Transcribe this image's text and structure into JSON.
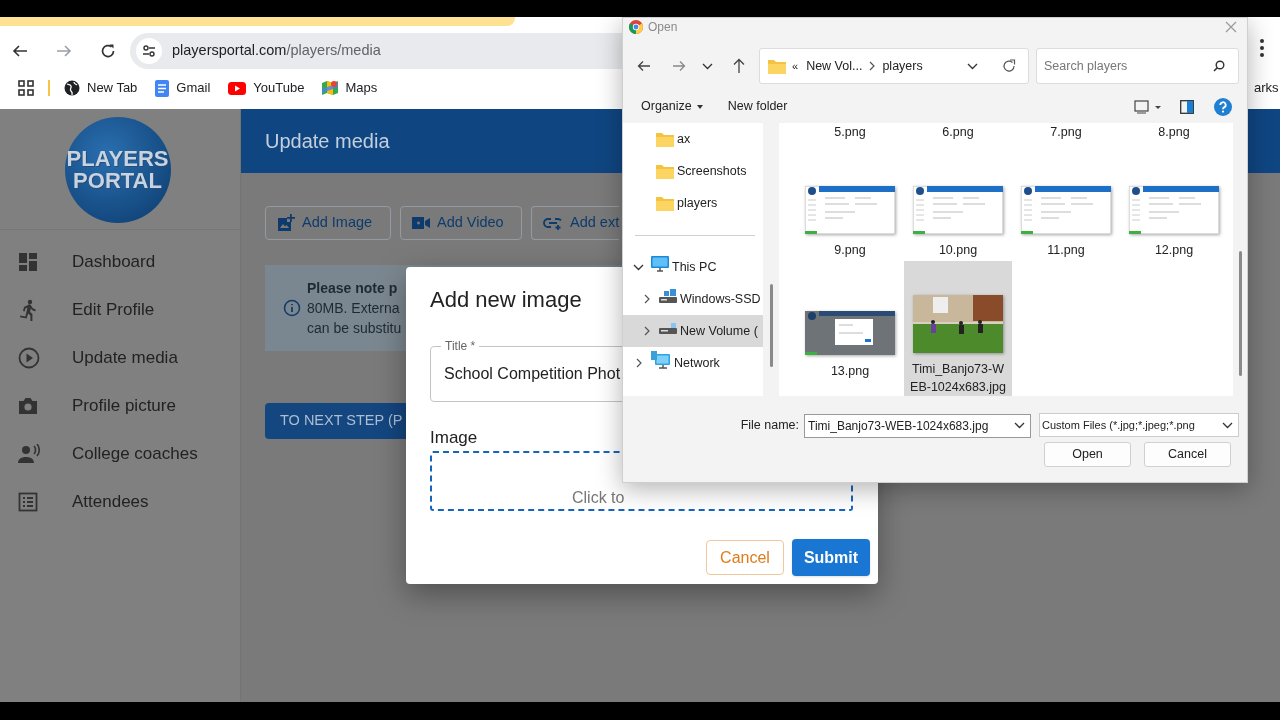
{
  "browser": {
    "url_host": "playersportal.com",
    "url_path": "/players/media",
    "bookmarks": [
      "New Tab",
      "Gmail",
      "YouTube",
      "Maps"
    ],
    "bookmarks_overflow": "arks"
  },
  "sidebar": {
    "logo": [
      "PLAYERS",
      "PORTAL"
    ],
    "items": [
      "Dashboard",
      "Edit Profile",
      "Update media",
      "Profile picture",
      "College coaches",
      "Attendees"
    ]
  },
  "page": {
    "title": "Update media",
    "actions": [
      "Add Image",
      "Add Video",
      "Add ext"
    ],
    "note": [
      "**Please note p**",
      "80MB. Externa",
      "can be substitu"
    ],
    "next_button": "TO NEXT STEP (P"
  },
  "modal": {
    "title": "Add new image",
    "title_field": {
      "label": "Title *",
      "value": "School Competition Phot"
    },
    "image_label": "Image",
    "dropzone": "Click to",
    "buttons": [
      "Cancel",
      "Submit"
    ]
  },
  "file_dialog": {
    "title": "Open",
    "path": [
      "«",
      "New Vol...",
      "players"
    ],
    "search": {
      "placeholder": "Search players"
    },
    "toolbar": [
      "Organize",
      "New folder"
    ],
    "quick_access": [
      {
        "label": "ax",
        "selected": false
      },
      {
        "label": "Screenshots",
        "selected": false
      },
      {
        "label": "players",
        "selected": false
      }
    ],
    "tree": [
      {
        "label": "This PC",
        "expanded": true,
        "selected": false,
        "children": [
          {
            "label": "Windows-SSD",
            "expanded": false,
            "selected": false
          },
          {
            "label": "New Volume (",
            "expanded": false,
            "selected": true
          }
        ]
      },
      {
        "label": "Network",
        "expanded": false,
        "selected": false
      }
    ],
    "files": [
      {
        "name": "5.png",
        "kind": "name_only",
        "selected": false
      },
      {
        "name": "6.png",
        "kind": "name_only",
        "selected": false
      },
      {
        "name": "7.png",
        "kind": "name_only",
        "selected": false
      },
      {
        "name": "8.png",
        "kind": "name_only",
        "selected": false
      },
      {
        "name": "9.png",
        "kind": "screenshot",
        "selected": false
      },
      {
        "name": "10.png",
        "kind": "screenshot",
        "selected": false
      },
      {
        "name": "11.png",
        "kind": "screenshot",
        "selected": false
      },
      {
        "name": "12.png",
        "kind": "screenshot",
        "selected": false
      },
      {
        "name": "13.png",
        "kind": "screenshot_dark",
        "selected": false
      },
      {
        "name": "Timi_Banjo73-WEB-1024x683.jpg",
        "kind": "photo",
        "selected": true
      }
    ],
    "file_name_label": "File name:",
    "file_name": "Timi_Banjo73-WEB-1024x683.jpg",
    "filter": "Custom Files (*.jpg;*.jpeg;*.png",
    "buttons": [
      "Open",
      "Cancel"
    ]
  }
}
